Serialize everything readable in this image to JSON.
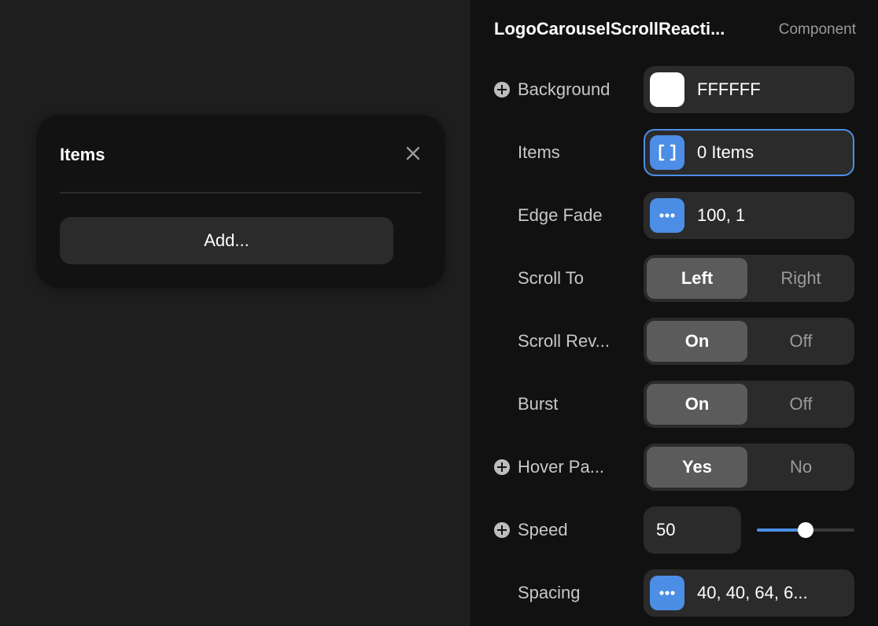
{
  "popover": {
    "title": "Items",
    "close_icon": "close-icon",
    "add_label": "Add..."
  },
  "panel": {
    "title": "LogoCarouselScrollReacti...",
    "kind": "Component",
    "background": {
      "label": "Background",
      "value": "FFFFFF",
      "color": "#ffffff",
      "icon": "plus-circle-icon"
    },
    "items": {
      "label": "Items",
      "value": "0 Items",
      "icon": "array-brackets-icon",
      "accent": "#4c8ee6"
    },
    "edge_fade": {
      "label": "Edge Fade",
      "value": "100, 1",
      "icon": "more-dots-icon",
      "accent": "#4c8ee6"
    },
    "scroll_to": {
      "label": "Scroll To",
      "options": [
        "Left",
        "Right"
      ],
      "selected": "Left"
    },
    "scroll_reverse": {
      "label": "Scroll Rev...",
      "options": [
        "On",
        "Off"
      ],
      "selected": "On"
    },
    "burst": {
      "label": "Burst",
      "options": [
        "On",
        "Off"
      ],
      "selected": "On"
    },
    "hover_pause": {
      "label": "Hover Pa...",
      "options": [
        "Yes",
        "No"
      ],
      "selected": "Yes",
      "icon": "plus-circle-icon"
    },
    "speed": {
      "label": "Speed",
      "value": "50",
      "slider_fraction": 0.5,
      "icon": "plus-circle-icon",
      "accent": "#4c8ee6"
    },
    "spacing": {
      "label": "Spacing",
      "value": "40, 40, 64, 6...",
      "icon": "more-dots-icon",
      "accent": "#4c8ee6"
    }
  }
}
